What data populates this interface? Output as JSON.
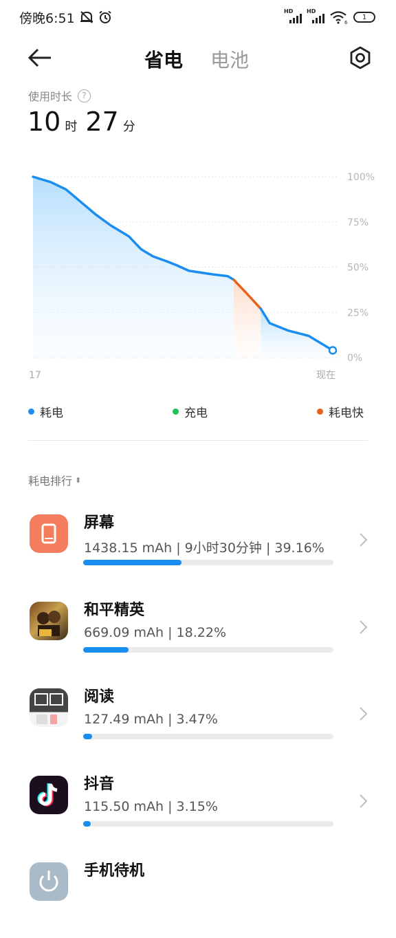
{
  "status_bar": {
    "time": "傍晚6:51",
    "hd1": "HD",
    "hd2": "HD",
    "wifi_sub": "6",
    "battery": "1"
  },
  "header": {
    "tabs": [
      {
        "label": "省电",
        "active": true
      },
      {
        "label": "电池",
        "active": false
      }
    ]
  },
  "usage": {
    "label": "使用时长",
    "hours": "10",
    "hours_unit": "时",
    "minutes": "27",
    "minutes_unit": "分"
  },
  "chart_data": {
    "type": "line",
    "x_labels": [
      "17",
      "现在"
    ],
    "y_ticks": [
      "100%",
      "75%",
      "50%",
      "25%",
      "0%"
    ],
    "ylim": [
      0,
      100
    ],
    "series": [
      {
        "name": "耗电",
        "color": "#1a8df0",
        "x": [
          0,
          0.06,
          0.11,
          0.16,
          0.21,
          0.26,
          0.32,
          0.36,
          0.4,
          0.45,
          0.48,
          0.52,
          0.6,
          0.65,
          0.67
        ],
        "values": [
          100,
          97,
          93,
          86,
          79,
          73,
          67,
          60,
          56,
          53,
          51,
          48,
          46,
          45,
          43
        ]
      },
      {
        "name": "耗电快",
        "color": "#e8621c",
        "x": [
          0.67,
          0.71,
          0.76
        ],
        "values": [
          43,
          36,
          27
        ]
      },
      {
        "name": "耗电",
        "color": "#1a8df0",
        "x": [
          0.76,
          0.79,
          0.85,
          0.92,
          0.96,
          1.0
        ],
        "values": [
          27,
          19,
          15,
          12,
          8,
          4
        ]
      }
    ],
    "legend": [
      {
        "label": "耗电",
        "color": "#1a8df0"
      },
      {
        "label": "充电",
        "color": "#21c05a"
      },
      {
        "label": "耗电快",
        "color": "#e8621c"
      }
    ],
    "grid": true
  },
  "ranking": {
    "title": "耗电排行",
    "apps": [
      {
        "name": "屏幕",
        "detail": "1438.15 mAh | 9小时30分钟 | 39.16%",
        "percent": 39.16,
        "icon": "screen-icon"
      },
      {
        "name": "和平精英",
        "detail": "669.09 mAh | 18.22%",
        "percent": 18.22,
        "icon": "game-icon"
      },
      {
        "name": "阅读",
        "detail": "127.49 mAh | 3.47%",
        "percent": 3.47,
        "icon": "reader-icon"
      },
      {
        "name": "抖音",
        "detail": "115.50 mAh | 3.15%",
        "percent": 3.15,
        "icon": "douyin-icon"
      },
      {
        "name": "手机待机",
        "detail": "",
        "percent": 0,
        "icon": "standby-icon"
      }
    ]
  }
}
